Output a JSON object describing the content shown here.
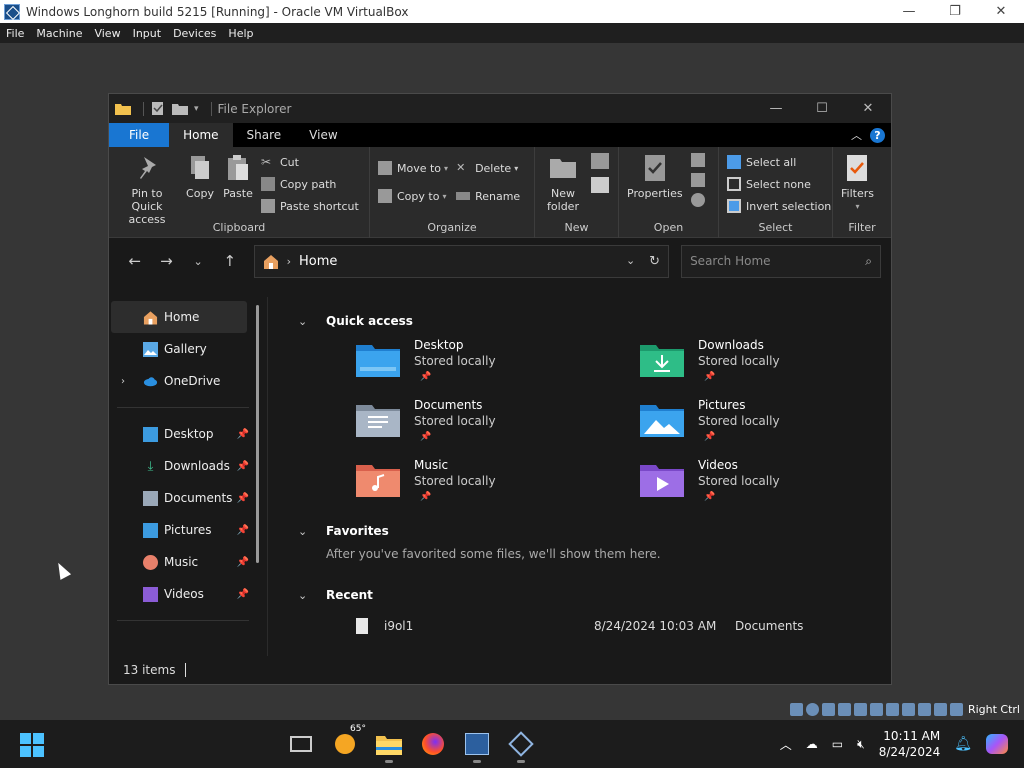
{
  "vbox": {
    "title": "Windows Longhorn build 5215 [Running] - Oracle VM VirtualBox",
    "menu": [
      "File",
      "Machine",
      "View",
      "Input",
      "Devices",
      "Help"
    ],
    "host_key": "Right Ctrl"
  },
  "explorer": {
    "title": "File Explorer",
    "tabs": {
      "file": "File",
      "home": "Home",
      "share": "Share",
      "view": "View"
    },
    "ribbon": {
      "clipboard": {
        "label": "Clipboard",
        "pin": "Pin to Quick access",
        "copy": "Copy",
        "paste": "Paste",
        "cut": "Cut",
        "copy_path": "Copy path",
        "paste_shortcut": "Paste shortcut"
      },
      "organize": {
        "label": "Organize",
        "move_to": "Move to",
        "copy_to": "Copy to",
        "delete": "Delete",
        "rename": "Rename"
      },
      "new": {
        "label": "New",
        "new_folder": "New folder"
      },
      "open": {
        "label": "Open",
        "properties": "Properties"
      },
      "select": {
        "label": "Select",
        "select_all": "Select all",
        "select_none": "Select none",
        "invert": "Invert selection"
      },
      "filter": {
        "label": "Filter",
        "filters": "Filters"
      }
    },
    "address": {
      "location": "Home"
    },
    "search": {
      "placeholder": "Search Home"
    },
    "nav": {
      "home": "Home",
      "gallery": "Gallery",
      "onedrive": "OneDrive",
      "pinned": [
        "Desktop",
        "Downloads",
        "Documents",
        "Pictures",
        "Music",
        "Videos"
      ]
    },
    "quick_access": {
      "heading": "Quick access",
      "items": [
        {
          "name": "Desktop",
          "sub": "Stored locally"
        },
        {
          "name": "Downloads",
          "sub": "Stored locally"
        },
        {
          "name": "Documents",
          "sub": "Stored locally"
        },
        {
          "name": "Pictures",
          "sub": "Stored locally"
        },
        {
          "name": "Music",
          "sub": "Stored locally"
        },
        {
          "name": "Videos",
          "sub": "Stored locally"
        }
      ]
    },
    "favorites": {
      "heading": "Favorites",
      "empty_text": "After you've favorited some files, we'll show them here."
    },
    "recent": {
      "heading": "Recent",
      "rows": [
        {
          "name": "i9ol1",
          "date": "8/24/2024 10:03 AM",
          "location": "Documents"
        }
      ]
    },
    "status": {
      "items": "13 items"
    }
  },
  "taskbar": {
    "weather": "65°",
    "time": "10:11 AM",
    "date": "8/24/2024"
  },
  "colors": {
    "accent": "#1976d2",
    "folder_yellow": "#f2c14e"
  }
}
